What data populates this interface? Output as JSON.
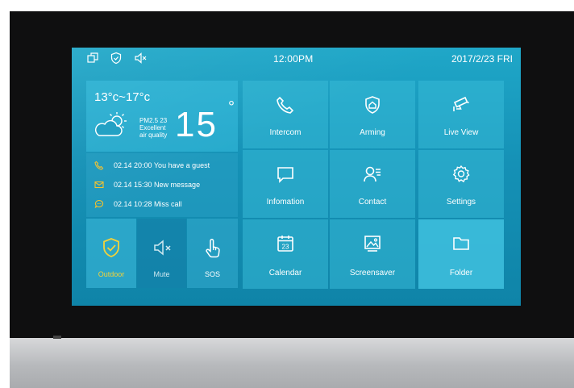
{
  "status": {
    "time": "12:00PM",
    "date": "2017/2/23 FRI",
    "icons": [
      "windows-icon",
      "shield-icon",
      "speaker-mute-icon"
    ]
  },
  "weather": {
    "temp_range": "13°c~17°c",
    "pm_line": "PM2.5  23",
    "quality_line1": "Excellent",
    "quality_line2": "air quality",
    "current_temp": "15",
    "degree_symbol": "°"
  },
  "messages": [
    {
      "icon": "phone-icon",
      "text": "02.14  20:00  You have a guest"
    },
    {
      "icon": "envelope-icon",
      "text": "02.14  15:30  New message"
    },
    {
      "icon": "chat-icon",
      "text": "02.14  10:28  Miss call"
    }
  ],
  "quick": {
    "outdoor": "Outdoor",
    "mute": "Mute",
    "sos": "SOS"
  },
  "tiles": {
    "intercom": "Intercom",
    "arming": "Arming",
    "live_view": "Live View",
    "information": "Infomation",
    "contact": "Contact",
    "settings": "Settings",
    "calendar": "Calendar",
    "calendar_day": "23",
    "screensaver": "Screensaver",
    "folder": "Folder"
  },
  "colors": {
    "screen": "#1591b6",
    "outdoor_accent": "#f2d23a",
    "message_icon": "#f2c12e"
  }
}
